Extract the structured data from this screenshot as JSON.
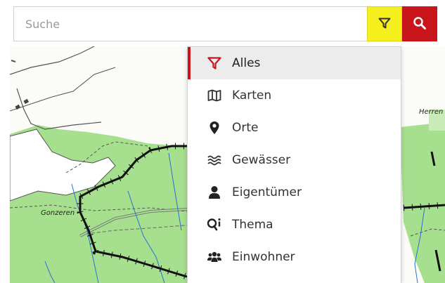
{
  "search": {
    "placeholder": "Suche",
    "value": ""
  },
  "buttons": {
    "filter_icon": "filter-icon",
    "search_icon": "search-icon",
    "filter_color": "#f5ef1e",
    "search_color": "#c8151c"
  },
  "map": {
    "labels": {
      "place_1": "Gonzeren",
      "place_2": "Herren"
    }
  },
  "filter_menu": {
    "selected": "Alles",
    "accent_color": "#c8151c",
    "items": [
      {
        "label": "Alles",
        "icon": "filter-icon",
        "active": true
      },
      {
        "label": "Karten",
        "icon": "map-icon",
        "active": false
      },
      {
        "label": "Orte",
        "icon": "map-marker-icon",
        "active": false
      },
      {
        "label": "Gewässer",
        "icon": "water-icon",
        "active": false
      },
      {
        "label": "Eigentümer",
        "icon": "user-icon",
        "active": false
      },
      {
        "label": "Thema",
        "icon": "theme-search-icon",
        "active": false
      },
      {
        "label": "Einwohner",
        "icon": "users-icon",
        "active": false
      }
    ]
  }
}
